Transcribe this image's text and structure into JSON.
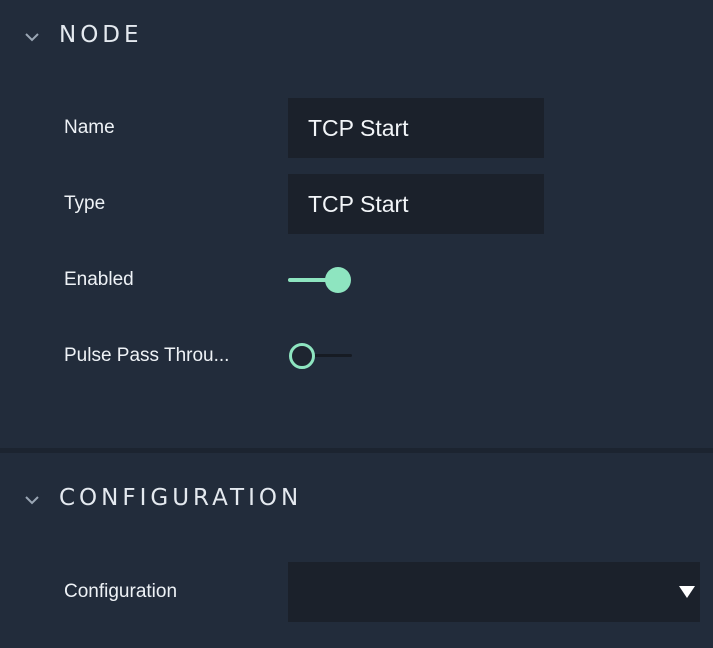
{
  "node_section": {
    "title": "NODE",
    "rows": {
      "name": {
        "label": "Name",
        "value": "TCP Start"
      },
      "type": {
        "label": "Type",
        "value": "TCP Start"
      },
      "enabled": {
        "label": "Enabled",
        "on": true
      },
      "pulse": {
        "label": "Pulse Pass Throu...",
        "on": false
      }
    }
  },
  "config_section": {
    "title": "CONFIGURATION",
    "configuration": {
      "label": "Configuration",
      "value": ""
    }
  },
  "colors": {
    "background": "#222c3b",
    "field": "#1b212b",
    "accent": "#8ee5c0",
    "text": "#eef2f6"
  },
  "icons": [
    "chevron-down-icon",
    "dropdown-arrow-icon"
  ]
}
